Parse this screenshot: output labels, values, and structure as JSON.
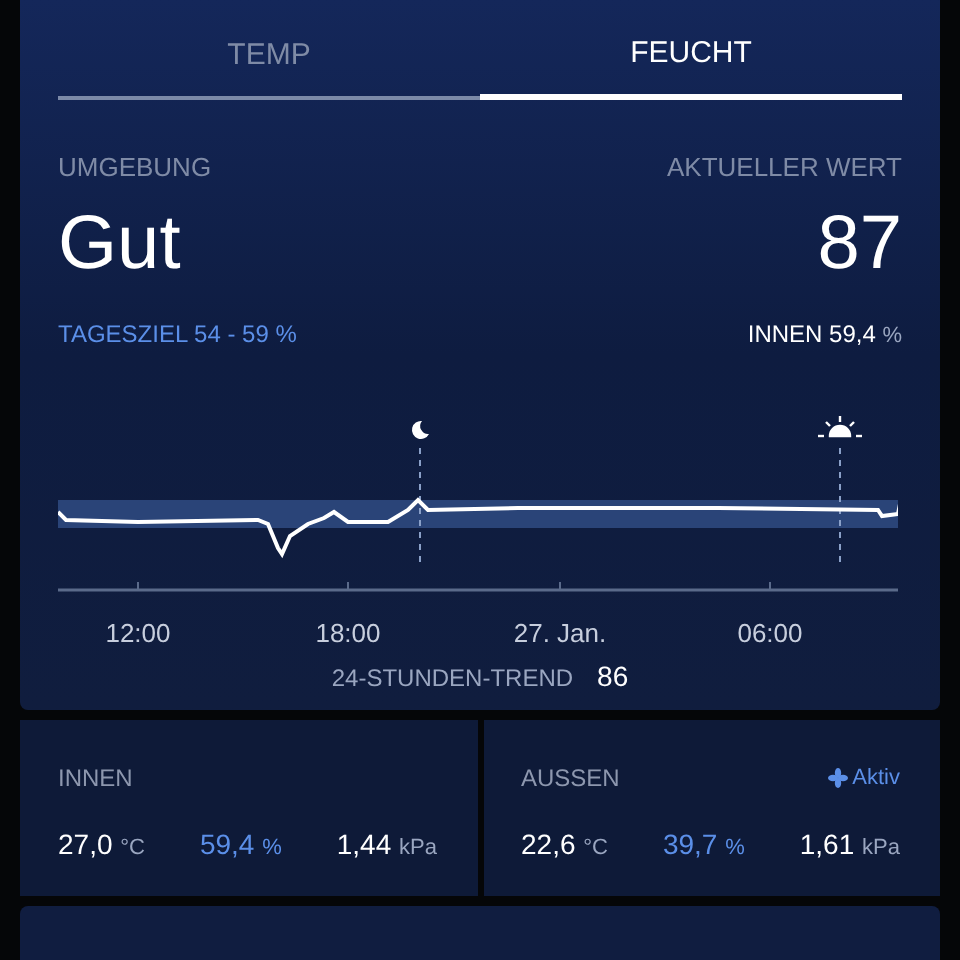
{
  "tabs": [
    {
      "label": "TEMP",
      "selected": false
    },
    {
      "label": "FEUCHT",
      "selected": true
    }
  ],
  "summary": {
    "left_label": "UMGEBUNG",
    "right_label": "AKTUELLER WERT",
    "status": "Gut",
    "value": "87",
    "target": "TAGESZIEL 54 - 59 %",
    "inside_label": "INNEN",
    "inside_value": "59,4",
    "inside_unit": "%"
  },
  "chart": {
    "x_labels": [
      "12:00",
      "18:00",
      "27. Jan.",
      "06:00"
    ],
    "trend_label": "24-STUNDEN-TREND",
    "trend_value": "86"
  },
  "panels": [
    {
      "title": "INNEN",
      "readings": [
        {
          "kind": "temp",
          "value": "27,0",
          "unit": "°C"
        },
        {
          "kind": "humidity",
          "value": "59,4",
          "unit": "%"
        },
        {
          "kind": "pressure",
          "value": "1,44",
          "unit": "kPa"
        }
      ]
    },
    {
      "title": "AUSSEN",
      "status": "Aktiv",
      "readings": [
        {
          "kind": "temp",
          "value": "22,6",
          "unit": "°C"
        },
        {
          "kind": "humidity",
          "value": "39,7",
          "unit": "%"
        },
        {
          "kind": "pressure",
          "value": "1,61",
          "unit": "kPa"
        }
      ]
    }
  ]
}
